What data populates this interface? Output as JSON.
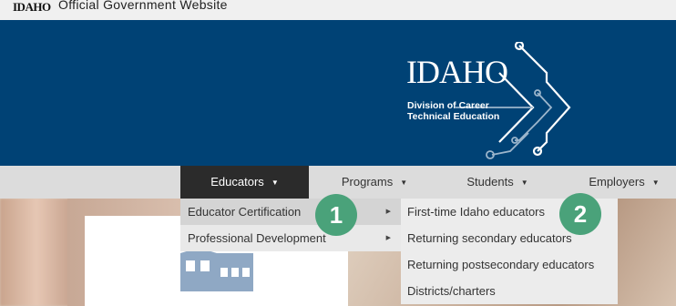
{
  "gov_bar": {
    "logo_text": "IDAHO",
    "label": "Official Government Website"
  },
  "header": {
    "logo_title": "IDAHO",
    "logo_subtitle_line1": "Division of Career",
    "logo_subtitle_line2": "Technical Education",
    "background_color": "#004275"
  },
  "nav": {
    "items": [
      {
        "label": "Educators",
        "active": true
      },
      {
        "label": "Programs",
        "active": false
      },
      {
        "label": "Students",
        "active": false
      },
      {
        "label": "Employers",
        "active": false
      }
    ],
    "caret": "▼"
  },
  "dropdown": {
    "items": [
      {
        "label": "Educator Certification",
        "has_submenu": true,
        "highlighted": true
      },
      {
        "label": "Professional Development",
        "has_submenu": true,
        "highlighted": false
      }
    ],
    "submenu_arrow": "▶"
  },
  "submenu": {
    "items": [
      "First-time Idaho educators",
      "Returning secondary educators",
      "Returning postsecondary educators",
      "Districts/charters"
    ]
  },
  "badges": {
    "step1": "1",
    "step2": "2",
    "color": "#4aa27a"
  }
}
